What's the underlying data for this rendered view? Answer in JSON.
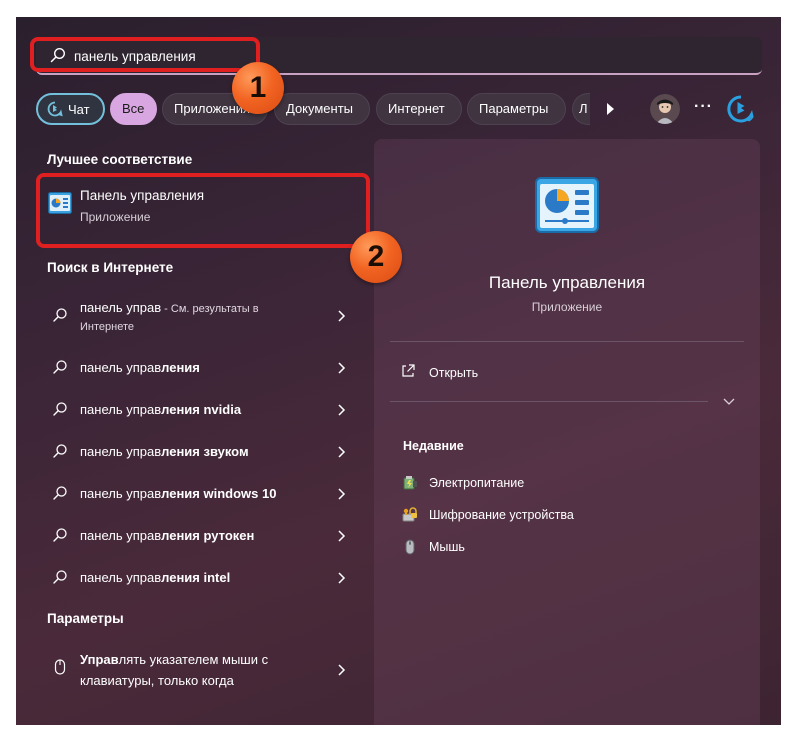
{
  "search": {
    "value": "панель управления"
  },
  "tabs": [
    {
      "label": "Чат"
    },
    {
      "label": "Все"
    },
    {
      "label": "Приложения"
    },
    {
      "label": "Документы"
    },
    {
      "label": "Интернет"
    },
    {
      "label": "Параметры"
    },
    {
      "label": "Л"
    }
  ],
  "more_label": "···",
  "best_match": {
    "heading": "Лучшее соответствие",
    "name": "Панель управления",
    "kind": "Приложение"
  },
  "web": {
    "heading": "Поиск в Интернете",
    "items": [
      {
        "query": "панель управ",
        "suffix": " - См. результаты в",
        "line2": "Интернете"
      },
      {
        "prefix": "панель управ",
        "bold": "ления"
      },
      {
        "prefix": "панель управ",
        "bold": "ления nvidia"
      },
      {
        "prefix": "панель управ",
        "bold": "ления звуком"
      },
      {
        "prefix": "панель управ",
        "bold": "ления windows 10"
      },
      {
        "prefix": "панель управ",
        "bold": "ления рутокен"
      },
      {
        "prefix": "панель управ",
        "bold": "ления intel"
      }
    ]
  },
  "settings": {
    "heading": "Параметры",
    "item_prefix": "Управ",
    "item_line1_rest": "лять указателем мыши с",
    "item_line2": "клавиатуры, только когда"
  },
  "preview": {
    "name": "Панель управления",
    "kind": "Приложение",
    "open_label": "Открыть",
    "recent_heading": "Недавние",
    "recent": [
      {
        "label": "Электропитание",
        "icon": "power-options-icon"
      },
      {
        "label": "Шифрование устройства",
        "icon": "device-encryption-icon"
      },
      {
        "label": "Мышь",
        "icon": "mouse-icon"
      }
    ]
  },
  "annotations": {
    "badge1": "1",
    "badge2": "2",
    "highlight_color": "#e02020",
    "badge_color": "#f26422"
  },
  "colors": {
    "accent": "#d8a6e0",
    "chat_border": "#73c0dc",
    "search_underline": "#c9a2c3"
  }
}
